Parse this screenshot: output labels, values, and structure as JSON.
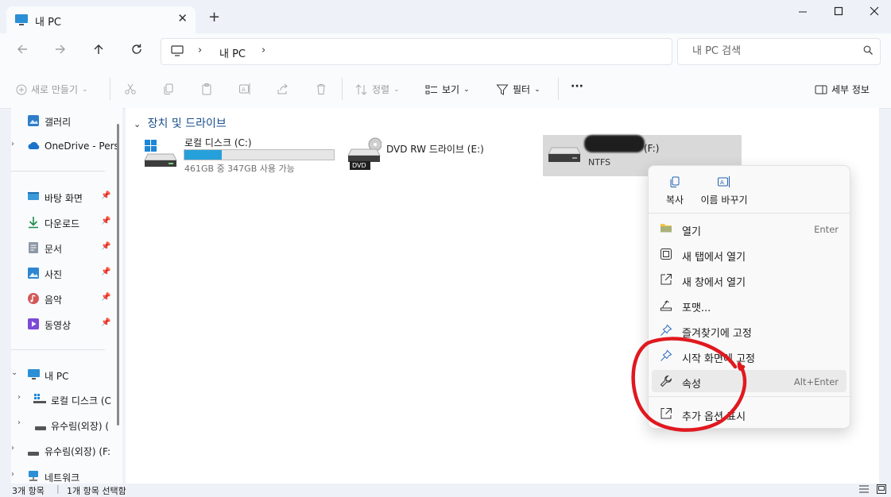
{
  "window": {
    "tab_title": "내 PC",
    "tab_close": "✕",
    "new_tab": "+"
  },
  "nav": {
    "breadcrumb": "내 PC",
    "search_placeholder": "내 PC 검색"
  },
  "commands": {
    "new": "새로 만들기",
    "sort": "정렬",
    "view": "보기",
    "filter": "필터",
    "more": "···",
    "details": "세부 정보"
  },
  "sidebar": {
    "gallery": "갤러리",
    "onedrive": "OneDrive - Pers",
    "desktop": "바탕 화면",
    "downloads": "다운로드",
    "documents": "문서",
    "pictures": "사진",
    "music": "음악",
    "videos": "동영상",
    "this_pc": "내 PC",
    "local_disk": "로컬 디스크 (C",
    "usb1": "유수림(외장) (",
    "usb2": "유수림(외장) (F:",
    "network": "네트워크"
  },
  "content": {
    "group_title": "장치 및 드라이브",
    "drives": [
      {
        "name": "로컬 디스크 (C:)",
        "detail": "461GB 중 347GB 사용 가능",
        "used_fraction": 0.25
      },
      {
        "name": "DVD RW 드라이브 (E:)",
        "badge": "DVD"
      },
      {
        "name": "(F:)",
        "detail": "NTFS"
      }
    ]
  },
  "context_menu": {
    "copy": "복사",
    "rename": "이름 바꾸기",
    "items": [
      {
        "label": "열기",
        "shortcut": "Enter"
      },
      {
        "label": "새 탭에서 열기"
      },
      {
        "label": "새 창에서 열기"
      },
      {
        "label": "포맷..."
      },
      {
        "label": "즐겨찾기에 고정"
      },
      {
        "label": "시작 화면에 고정"
      },
      {
        "label": "속성",
        "shortcut": "Alt+Enter"
      },
      {
        "label": "추가 옵션 표시"
      }
    ]
  },
  "status": {
    "count": "3개 항목",
    "selected": "1개 항목 선택함"
  },
  "colors": {
    "accent": "#26a0da",
    "annotation": "#e0191f"
  }
}
